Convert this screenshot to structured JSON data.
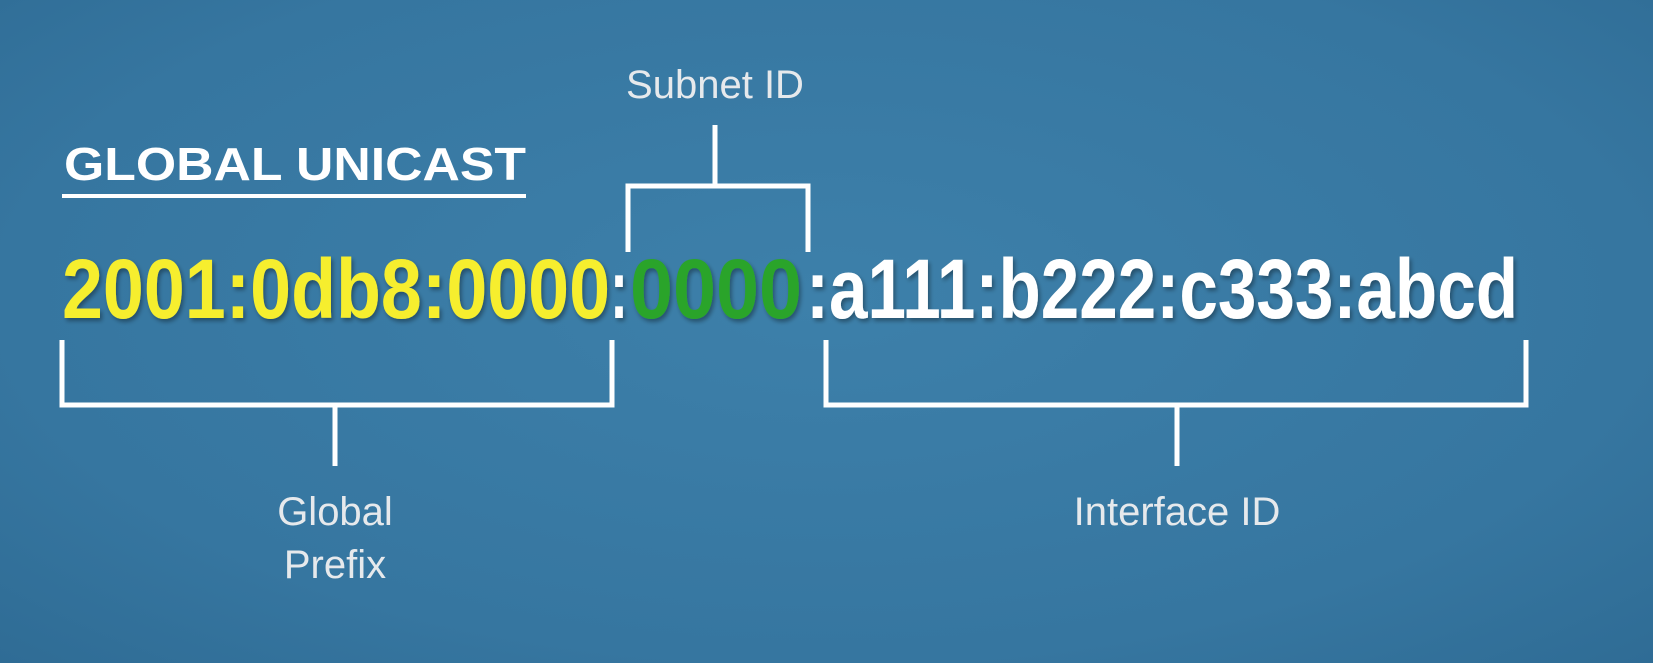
{
  "title": "GLOBAL UNICAST",
  "address": {
    "global_prefix": "2001:0db8:0000",
    "separator": ":",
    "subnet_id": "0000",
    "interface_id": ":a111:b222:c333:abcd"
  },
  "labels": {
    "subnet_id": "Subnet ID",
    "global_prefix_line1": "Global",
    "global_prefix_line2": "Prefix",
    "interface_id": "Interface ID"
  },
  "colors": {
    "global_prefix": "#f6ee2f",
    "subnet_id": "#2ca42c",
    "interface_id": "#ffffff"
  }
}
